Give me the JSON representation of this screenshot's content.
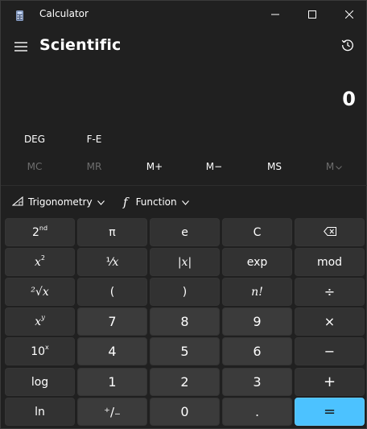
{
  "window": {
    "title": "Calculator",
    "icons": [
      "calculator-app-icon",
      "minimize-icon",
      "maximize-icon",
      "close-icon"
    ]
  },
  "header": {
    "mode": "Scientific",
    "menu_icon": "hamburger-icon",
    "history_icon": "history-icon"
  },
  "display": {
    "value": "0"
  },
  "angle": {
    "unit": "DEG",
    "fe": "F-E"
  },
  "memory": {
    "mc": "MC",
    "mr": "MR",
    "mplus": "M+",
    "mminus": "M−",
    "ms": "MS",
    "mv": "M"
  },
  "functions": {
    "trig": "Trigonometry",
    "func": "Function",
    "func_glyph": "f"
  },
  "keys": {
    "second": "2",
    "second_sup": "nd",
    "pi": "π",
    "e": "e",
    "clear": "C",
    "backspace_icon": "backspace-icon",
    "square_base": "x",
    "square_sup": "2",
    "reciprocal": "⅟",
    "reciprocal_x": "x",
    "abs": "|x|",
    "exp": "exp",
    "mod": "mod",
    "sqrt": "²√x",
    "lparen": "(",
    "rparen": ")",
    "factorial": "n!",
    "divide": "÷",
    "pow_base": "x",
    "pow_sup": "y",
    "seven": "7",
    "eight": "8",
    "nine": "9",
    "multiply": "×",
    "tenpow_base": "10",
    "tenpow_sup": "x",
    "four": "4",
    "five": "5",
    "six": "6",
    "minus": "−",
    "log": "log",
    "one": "1",
    "two": "2",
    "three": "3",
    "plus": "+",
    "ln": "ln",
    "negate": "⁺/₋",
    "zero": "0",
    "decimal": ".",
    "equals": "="
  },
  "colors": {
    "background": "#202020",
    "key_fn": "#323232",
    "key_num": "#3b3b3b",
    "accent": "#4cc2ff"
  }
}
